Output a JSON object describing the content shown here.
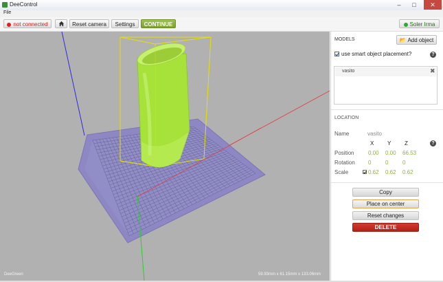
{
  "window": {
    "title": "DeeControl",
    "menu_file": "File",
    "minimize": "–",
    "maximize": "□",
    "close": "✕"
  },
  "toolbar": {
    "status_label": "not connected",
    "status_color": "#e02020",
    "home_icon": "home-icon",
    "reset_camera": "Reset camera",
    "settings": "Settings",
    "continue": "CONTINUE",
    "user_label": "Soler Irma",
    "user_status_color": "#2fa82f"
  },
  "viewport": {
    "brand": "DeeGreen",
    "dimensions": "59.93mm x 61.15mm x 133.06mm"
  },
  "models": {
    "title": "MODELS",
    "add_object": "Add object",
    "smart_placement_label": "use smart object placement?",
    "smart_placement_checked": true,
    "items": [
      {
        "name": "vasito"
      }
    ]
  },
  "location": {
    "title": "LOCATION",
    "name_label": "Name",
    "name_value": "vasito",
    "col_x": "X",
    "col_y": "Y",
    "col_z": "Z",
    "position_label": "Position",
    "position": [
      "0.00",
      "0.00",
      "66.53"
    ],
    "rotation_label": "Rotation",
    "rotation": [
      "0",
      "0",
      "0"
    ],
    "scale_label": "Scale",
    "scale_locked": true,
    "scale": [
      "0.62",
      "0.62",
      "0.62"
    ]
  },
  "actions": {
    "copy": "Copy",
    "place_on_center": "Place on center",
    "reset_changes": "Reset changes",
    "delete": "DELETE"
  },
  "colors": {
    "accent_green": "#8db13d",
    "delete_red": "#c0281e",
    "plate": "#8d88c4",
    "model": "#a6e23a"
  }
}
